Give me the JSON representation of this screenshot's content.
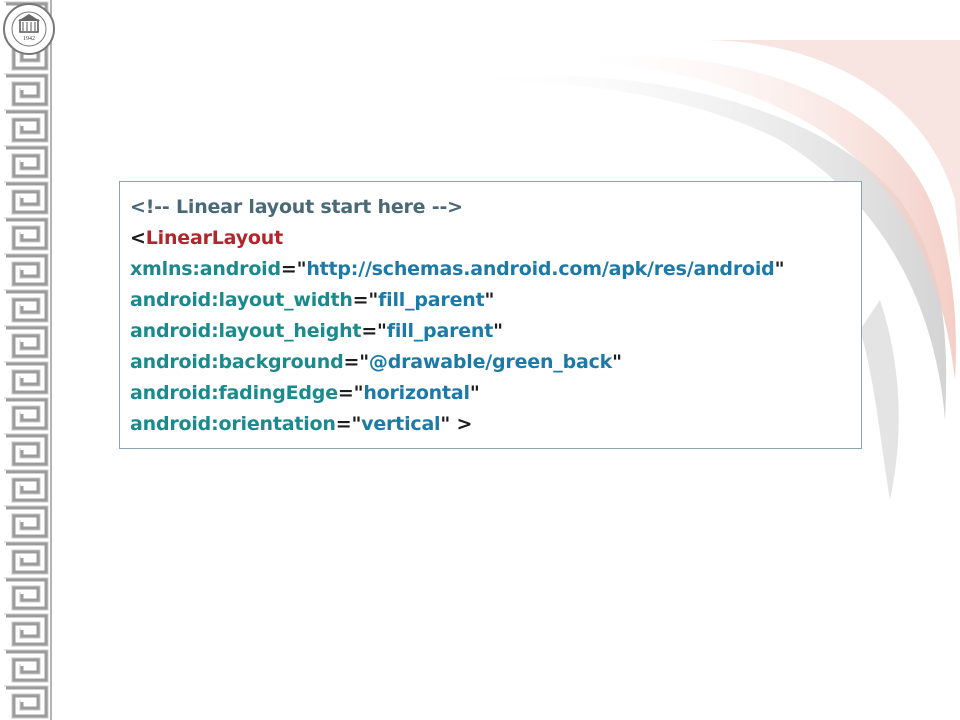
{
  "seal": {
    "ring_text": "NATIONAL UNIVERSITY OF MONGOLIA",
    "year": "1942",
    "icon": "university-seal"
  },
  "colors": {
    "comment": "#4a6978",
    "tag": "#b2262b",
    "attribute": "#1b8a8c",
    "value": "#1c7aa8",
    "punct": "#1c1c1c",
    "box_border": "#8aa3b5"
  },
  "code": {
    "comment": "<!-- Linear layout start here -->",
    "open_bracket": "<",
    "tag_name": "LinearLayout",
    "lines": [
      {
        "attr": "xmlns:android",
        "eq": "=\"",
        "value": "http://schemas.android.com/apk/res/android",
        "close": "\""
      },
      {
        "attr": "android:layout_width",
        "eq": "=\"",
        "value": "fill_parent",
        "close": "\""
      },
      {
        "attr": "android:layout_height",
        "eq": "=\"",
        "value": "fill_parent",
        "close": "\""
      },
      {
        "attr": "android:background",
        "eq": "=\"",
        "value": "@drawable/green_back",
        "close": "\""
      },
      {
        "attr": "android:fadingEdge",
        "eq": "=\"",
        "value": "horizontal",
        "close": "\""
      },
      {
        "attr": "android:orientation",
        "eq": "=\"",
        "value": "vertical",
        "close": "\" >"
      }
    ]
  }
}
